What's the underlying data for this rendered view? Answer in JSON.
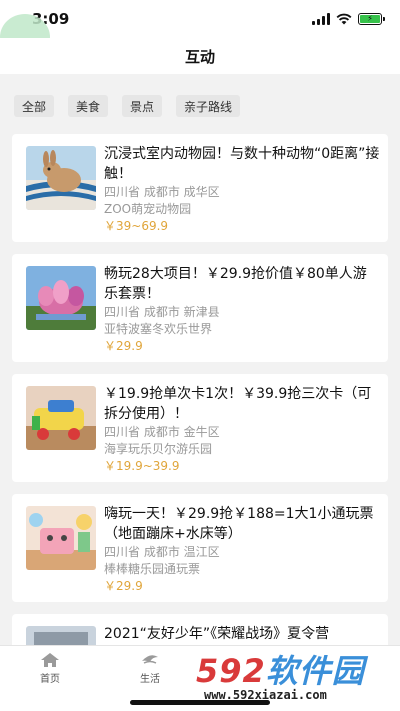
{
  "status_bar": {
    "time": "3:09"
  },
  "header": {
    "title": "互动"
  },
  "filters": [
    "全部",
    "美食",
    "景点",
    "亲子路线"
  ],
  "items": [
    {
      "title": "沉浸式室内动物园！与数十种动物“0距离”接触！",
      "region": "四川省 成都市 成华区",
      "venue": "ZOO萌宠动物园",
      "price": "￥39~69.9"
    },
    {
      "title": "畅玩28大项目！￥29.9抢价值￥80单人游乐套票！",
      "region": "四川省 成都市 新津县",
      "venue": "亚特波塞冬欢乐世界",
      "price": "￥29.9"
    },
    {
      "title": "￥19.9抢单次卡1次！￥39.9抢三次卡（可拆分使用）！",
      "region": "四川省 成都市 金牛区",
      "venue": "海享玩乐贝尔游乐园",
      "price": "￥19.9~39.9"
    },
    {
      "title": "嗨玩一天！￥29.9抢￥188=1大1小通玩票（地面蹦床+水床等）",
      "region": "四川省 成都市 温江区",
      "venue": "棒棒糖乐园通玩票",
      "price": "￥29.9"
    },
    {
      "title": "2021“友好少年”《荣耀战场》夏令营"
    }
  ],
  "tabbar": [
    {
      "label": "首页",
      "icon": "home-icon"
    },
    {
      "label": "生活",
      "icon": "life-icon"
    }
  ],
  "watermark": {
    "logo_num": "592",
    "logo_text": "软件园",
    "url": "www.592xiazai.com"
  },
  "colors": {
    "price": "#e0a53a",
    "background": "#f2f2f2",
    "tag_bg": "#e6e6e6"
  }
}
